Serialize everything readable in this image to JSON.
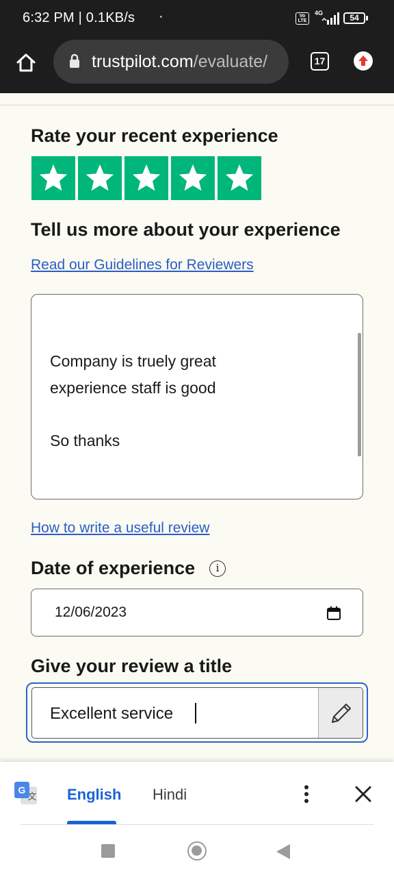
{
  "status_bar": {
    "time_speed": "6:32 PM | 0.1KB/s",
    "dot": "·",
    "volte": "Vo LTE",
    "network": "4G",
    "battery": "54"
  },
  "browser": {
    "url_host": "trustpilot.com",
    "url_path": "/evaluate/",
    "tab_count": "17"
  },
  "page": {
    "rate_heading": "Rate your recent experience",
    "rating": 5,
    "rating_max": 5,
    "star_color": "#00b67a",
    "tell_heading": "Tell us more about your experience",
    "guidelines_link": "Read our Guidelines for Reviewers",
    "review_text": "Company is truely great\nexperience staff is good\n\nSo thanks",
    "useful_review_link": "How to write a useful review",
    "date_heading": "Date of experience",
    "info_symbol": "i",
    "date_value": "12/06/2023",
    "title_heading": "Give your review a title",
    "title_value": "Excellent service "
  },
  "translate_bar": {
    "lang_selected": "English",
    "lang_other": "Hindi",
    "accent_color": "#1a63d6"
  }
}
